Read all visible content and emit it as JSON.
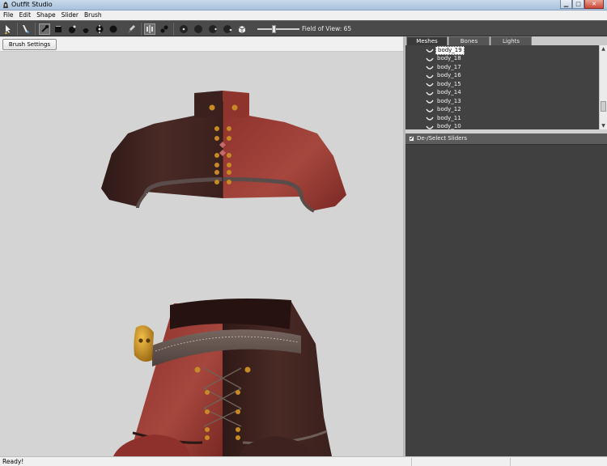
{
  "window": {
    "title": "Outfit Studio"
  },
  "menu": [
    "File",
    "Edit",
    "Shape",
    "Slider",
    "Brush"
  ],
  "toolbar": {
    "fov_label": "Field of View: 65",
    "fov_value": 65,
    "icons": [
      "select-icon",
      "brush-icon",
      "mask-brush-icon",
      "inflate-brush-icon",
      "deflate-brush-icon",
      "move-brush-icon",
      "smooth-brush-icon",
      "undiff-brush-icon",
      "weight-brush-icon",
      "color-brush-icon",
      "mirror-icon",
      "connected-icon",
      "view-front-icon",
      "view-back-icon",
      "view-left-icon",
      "view-right-icon",
      "perspective-icon"
    ]
  },
  "brush_settings": {
    "label": "Brush Settings >>"
  },
  "right_panel": {
    "tabs": [
      "Meshes",
      "Bones",
      "Lights"
    ],
    "active_tab": "Meshes",
    "meshes": [
      "body_19",
      "body_18",
      "body_17",
      "body_16",
      "body_15",
      "body_14",
      "body_13",
      "body_12",
      "body_11",
      "body_10"
    ],
    "selected_mesh": "body_19",
    "slider_header": "De-/Select Sliders",
    "slider_header_checked": true
  },
  "status": {
    "text": "Ready!"
  },
  "colors": {
    "toolbar_bg": "#4a4a4a",
    "panel_bg": "#3e3e3e",
    "viewport_bg": "#d3d4d3",
    "fabric_red": "#963a35",
    "fabric_dark": "#3f2320"
  }
}
